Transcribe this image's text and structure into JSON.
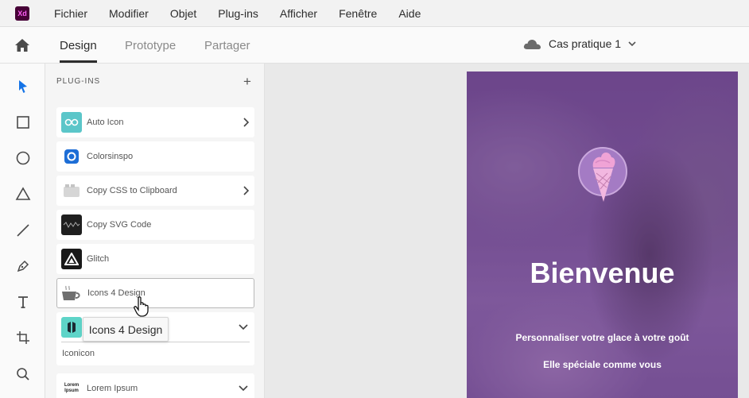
{
  "app": {
    "logo_text": "Xd"
  },
  "menu": [
    "Fichier",
    "Modifier",
    "Objet",
    "Plug-ins",
    "Afficher",
    "Fenêtre",
    "Aide"
  ],
  "tabs": {
    "design": "Design",
    "prototype": "Prototype",
    "share": "Partager"
  },
  "document": {
    "title": "Cas pratique 1"
  },
  "panel": {
    "title": "PLUG-INS",
    "add_label": "+",
    "plugins": [
      {
        "label": "Auto Icon"
      },
      {
        "label": "Colorsinspo"
      },
      {
        "label": "Copy CSS to Clipboard"
      },
      {
        "label": "Copy SVG Code"
      },
      {
        "label": "Glitch"
      },
      {
        "label": "Icons 4 Design"
      },
      {
        "label": "Lorem Ipsum",
        "icon_text_1": "Lorem",
        "icon_text_2": "Ipsum"
      }
    ],
    "expanded_sub_item": "Iconicon",
    "tooltip": "Icons 4 Design"
  },
  "artboard": {
    "title": "Bienvenue",
    "subtitle_1": "Personnaliser votre glace à votre goût",
    "subtitle_2": "Elle spéciale comme vous"
  },
  "colors": {
    "accent": "#1473e6",
    "artboard_tint": "#6a3d8c",
    "xd_brand": "#470137"
  }
}
